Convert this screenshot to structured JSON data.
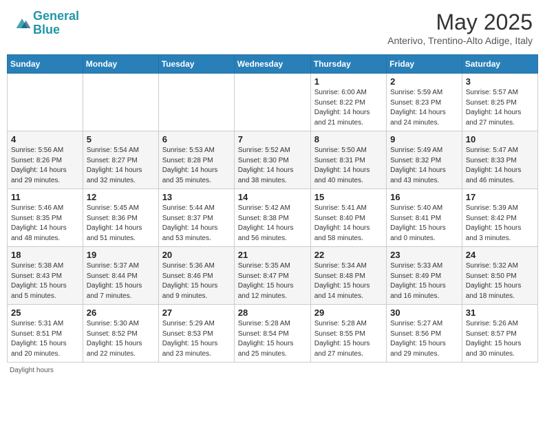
{
  "header": {
    "logo_line1": "General",
    "logo_line2": "Blue",
    "month_title": "May 2025",
    "subtitle": "Anterivo, Trentino-Alto Adige, Italy"
  },
  "days_of_week": [
    "Sunday",
    "Monday",
    "Tuesday",
    "Wednesday",
    "Thursday",
    "Friday",
    "Saturday"
  ],
  "weeks": [
    [
      {
        "day": "",
        "info": ""
      },
      {
        "day": "",
        "info": ""
      },
      {
        "day": "",
        "info": ""
      },
      {
        "day": "",
        "info": ""
      },
      {
        "day": "1",
        "info": "Sunrise: 6:00 AM\nSunset: 8:22 PM\nDaylight: 14 hours\nand 21 minutes."
      },
      {
        "day": "2",
        "info": "Sunrise: 5:59 AM\nSunset: 8:23 PM\nDaylight: 14 hours\nand 24 minutes."
      },
      {
        "day": "3",
        "info": "Sunrise: 5:57 AM\nSunset: 8:25 PM\nDaylight: 14 hours\nand 27 minutes."
      }
    ],
    [
      {
        "day": "4",
        "info": "Sunrise: 5:56 AM\nSunset: 8:26 PM\nDaylight: 14 hours\nand 29 minutes."
      },
      {
        "day": "5",
        "info": "Sunrise: 5:54 AM\nSunset: 8:27 PM\nDaylight: 14 hours\nand 32 minutes."
      },
      {
        "day": "6",
        "info": "Sunrise: 5:53 AM\nSunset: 8:28 PM\nDaylight: 14 hours\nand 35 minutes."
      },
      {
        "day": "7",
        "info": "Sunrise: 5:52 AM\nSunset: 8:30 PM\nDaylight: 14 hours\nand 38 minutes."
      },
      {
        "day": "8",
        "info": "Sunrise: 5:50 AM\nSunset: 8:31 PM\nDaylight: 14 hours\nand 40 minutes."
      },
      {
        "day": "9",
        "info": "Sunrise: 5:49 AM\nSunset: 8:32 PM\nDaylight: 14 hours\nand 43 minutes."
      },
      {
        "day": "10",
        "info": "Sunrise: 5:47 AM\nSunset: 8:33 PM\nDaylight: 14 hours\nand 46 minutes."
      }
    ],
    [
      {
        "day": "11",
        "info": "Sunrise: 5:46 AM\nSunset: 8:35 PM\nDaylight: 14 hours\nand 48 minutes."
      },
      {
        "day": "12",
        "info": "Sunrise: 5:45 AM\nSunset: 8:36 PM\nDaylight: 14 hours\nand 51 minutes."
      },
      {
        "day": "13",
        "info": "Sunrise: 5:44 AM\nSunset: 8:37 PM\nDaylight: 14 hours\nand 53 minutes."
      },
      {
        "day": "14",
        "info": "Sunrise: 5:42 AM\nSunset: 8:38 PM\nDaylight: 14 hours\nand 56 minutes."
      },
      {
        "day": "15",
        "info": "Sunrise: 5:41 AM\nSunset: 8:40 PM\nDaylight: 14 hours\nand 58 minutes."
      },
      {
        "day": "16",
        "info": "Sunrise: 5:40 AM\nSunset: 8:41 PM\nDaylight: 15 hours\nand 0 minutes."
      },
      {
        "day": "17",
        "info": "Sunrise: 5:39 AM\nSunset: 8:42 PM\nDaylight: 15 hours\nand 3 minutes."
      }
    ],
    [
      {
        "day": "18",
        "info": "Sunrise: 5:38 AM\nSunset: 8:43 PM\nDaylight: 15 hours\nand 5 minutes."
      },
      {
        "day": "19",
        "info": "Sunrise: 5:37 AM\nSunset: 8:44 PM\nDaylight: 15 hours\nand 7 minutes."
      },
      {
        "day": "20",
        "info": "Sunrise: 5:36 AM\nSunset: 8:46 PM\nDaylight: 15 hours\nand 9 minutes."
      },
      {
        "day": "21",
        "info": "Sunrise: 5:35 AM\nSunset: 8:47 PM\nDaylight: 15 hours\nand 12 minutes."
      },
      {
        "day": "22",
        "info": "Sunrise: 5:34 AM\nSunset: 8:48 PM\nDaylight: 15 hours\nand 14 minutes."
      },
      {
        "day": "23",
        "info": "Sunrise: 5:33 AM\nSunset: 8:49 PM\nDaylight: 15 hours\nand 16 minutes."
      },
      {
        "day": "24",
        "info": "Sunrise: 5:32 AM\nSunset: 8:50 PM\nDaylight: 15 hours\nand 18 minutes."
      }
    ],
    [
      {
        "day": "25",
        "info": "Sunrise: 5:31 AM\nSunset: 8:51 PM\nDaylight: 15 hours\nand 20 minutes."
      },
      {
        "day": "26",
        "info": "Sunrise: 5:30 AM\nSunset: 8:52 PM\nDaylight: 15 hours\nand 22 minutes."
      },
      {
        "day": "27",
        "info": "Sunrise: 5:29 AM\nSunset: 8:53 PM\nDaylight: 15 hours\nand 23 minutes."
      },
      {
        "day": "28",
        "info": "Sunrise: 5:28 AM\nSunset: 8:54 PM\nDaylight: 15 hours\nand 25 minutes."
      },
      {
        "day": "29",
        "info": "Sunrise: 5:28 AM\nSunset: 8:55 PM\nDaylight: 15 hours\nand 27 minutes."
      },
      {
        "day": "30",
        "info": "Sunrise: 5:27 AM\nSunset: 8:56 PM\nDaylight: 15 hours\nand 29 minutes."
      },
      {
        "day": "31",
        "info": "Sunrise: 5:26 AM\nSunset: 8:57 PM\nDaylight: 15 hours\nand 30 minutes."
      }
    ]
  ],
  "footer": {
    "daylight_label": "Daylight hours"
  }
}
